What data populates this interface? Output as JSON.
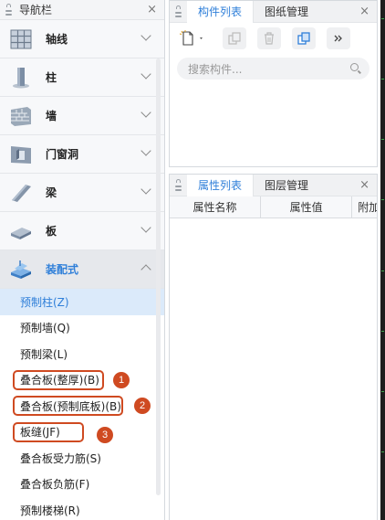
{
  "nav": {
    "title": "导航栏",
    "close": "×",
    "categories": [
      {
        "label": "轴线",
        "icon": "grid-axis-icon"
      },
      {
        "label": "柱",
        "icon": "column-icon"
      },
      {
        "label": "墙",
        "icon": "wall-icon"
      },
      {
        "label": "门窗洞",
        "icon": "door-window-icon"
      },
      {
        "label": "梁",
        "icon": "beam-icon"
      },
      {
        "label": "板",
        "icon": "slab-icon"
      },
      {
        "label": "装配式",
        "icon": "prefab-icon",
        "expanded": true
      }
    ],
    "sub_items": [
      {
        "label": "预制柱(Z)",
        "selected": true
      },
      {
        "label": "预制墙(Q)"
      },
      {
        "label": "预制梁(L)"
      },
      {
        "label": "叠合板(整厚)(B)",
        "badge": "1"
      },
      {
        "label": "叠合板(预制底板)(B)",
        "badge": "2"
      },
      {
        "label": "板缝(JF)",
        "badge": "3"
      },
      {
        "label": "叠合板受力筋(S)"
      },
      {
        "label": "叠合板负筋(F)"
      },
      {
        "label": "预制楼梯(R)"
      }
    ]
  },
  "component_panel": {
    "tabs": [
      "构件列表",
      "图纸管理"
    ],
    "close": "×",
    "search_placeholder": "搜索构件..."
  },
  "property_panel": {
    "tabs": [
      "属性列表",
      "图层管理"
    ],
    "close": "×",
    "columns": [
      "属性名称",
      "属性值",
      "附加"
    ]
  },
  "colors": {
    "accent": "#2f7fd9",
    "highlight": "#cf4a21",
    "selected_bg": "#dbeafa"
  }
}
